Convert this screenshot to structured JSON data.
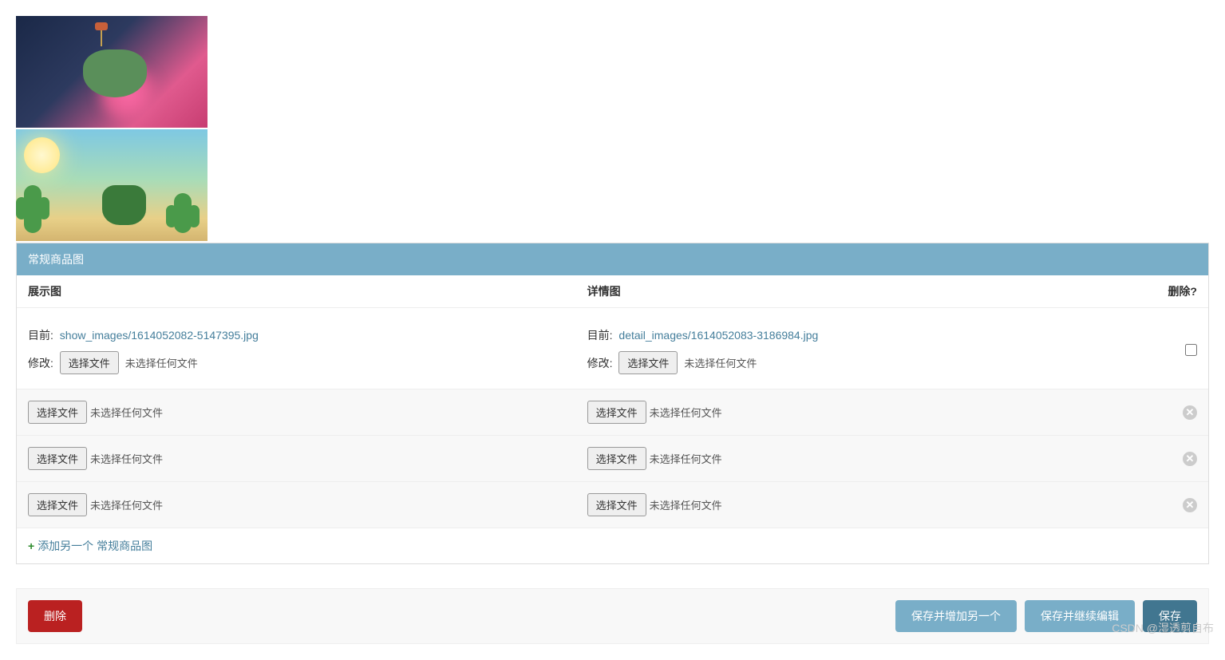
{
  "section": {
    "header": "常规商品图",
    "columns": {
      "show": "展示图",
      "detail": "详情图",
      "delete": "删除?"
    },
    "labels": {
      "current": "目前:",
      "change": "修改:"
    },
    "file_input": {
      "button": "选择文件",
      "no_file": "未选择任何文件"
    },
    "existing_row": {
      "show_path": "show_images/1614052082-5147395.jpg",
      "detail_path": "detail_images/1614052083-3186984.jpg"
    },
    "extra_rows_count": 3,
    "add_another": "添加另一个 常规商品图"
  },
  "actions": {
    "delete": "删除",
    "save_add_another": "保存并增加另一个",
    "save_continue": "保存并继续编辑",
    "save": "保存"
  },
  "watermark": "CSDN @湿透剪自布"
}
